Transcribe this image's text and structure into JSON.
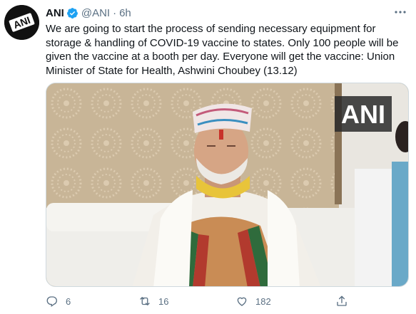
{
  "tweet": {
    "author_name": "ANI",
    "handle": "@ANI",
    "separator": "·",
    "time": "6h",
    "text": "We are going to start the process of sending necessary equipment for storage & handling of COVID-19 vaccine to states. Only 100 people will be given the vaccine at a booth per day. Everyone will get the vaccine: Union Minister of State for Health, Ashwini Choubey (13.12)",
    "media_watermark": "ANI",
    "avatar_logo_text": "ANI"
  },
  "actions": {
    "reply_count": "6",
    "retweet_count": "16",
    "like_count": "182"
  },
  "icons": {
    "verified": "verified-badge-icon",
    "more": "more-options-icon",
    "reply": "reply-icon",
    "retweet": "retweet-icon",
    "like": "heart-icon",
    "share": "share-icon"
  },
  "colors": {
    "verified_blue": "#1da1f2",
    "secondary_text": "#5b7083",
    "primary_text": "#0f1419"
  }
}
